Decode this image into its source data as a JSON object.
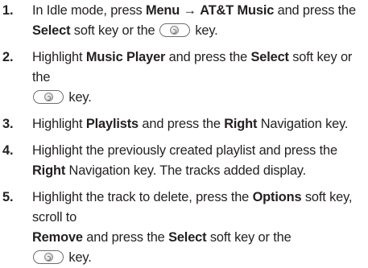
{
  "steps": [
    {
      "number": "1.",
      "t1": "In Idle mode, press ",
      "b1": "Menu",
      "t2": " ",
      "arrow": "→",
      "t3": " ",
      "b2": "AT&T Music",
      "t4": " and press the ",
      "b3": "Select",
      "t5": " soft key or the ",
      "t6": " key."
    },
    {
      "number": "2.",
      "t1": "Highlight ",
      "b1": "Music Player",
      "t2": " and press the ",
      "b2": "Select",
      "t3": " soft key or the ",
      "t4": " key."
    },
    {
      "number": "3.",
      "t1": "Highlight ",
      "b1": "Playlists",
      "t2": " and press the ",
      "b2": "Right",
      "t3": " Navigation key."
    },
    {
      "number": "4.",
      "t1": "Highlight the previously created playlist and press the ",
      "b1": "Right",
      "t2": " Navigation key. The tracks added display."
    },
    {
      "number": "5.",
      "t1": "Highlight the track to delete, press the ",
      "b1": "Options",
      "t2": " soft key, scroll to ",
      "b2": "Remove",
      "t3": " and press the ",
      "b3": "Select",
      "t4": " soft key or the ",
      "t5": " key."
    }
  ],
  "icons": {
    "select_key": "ok-select-key-icon"
  }
}
